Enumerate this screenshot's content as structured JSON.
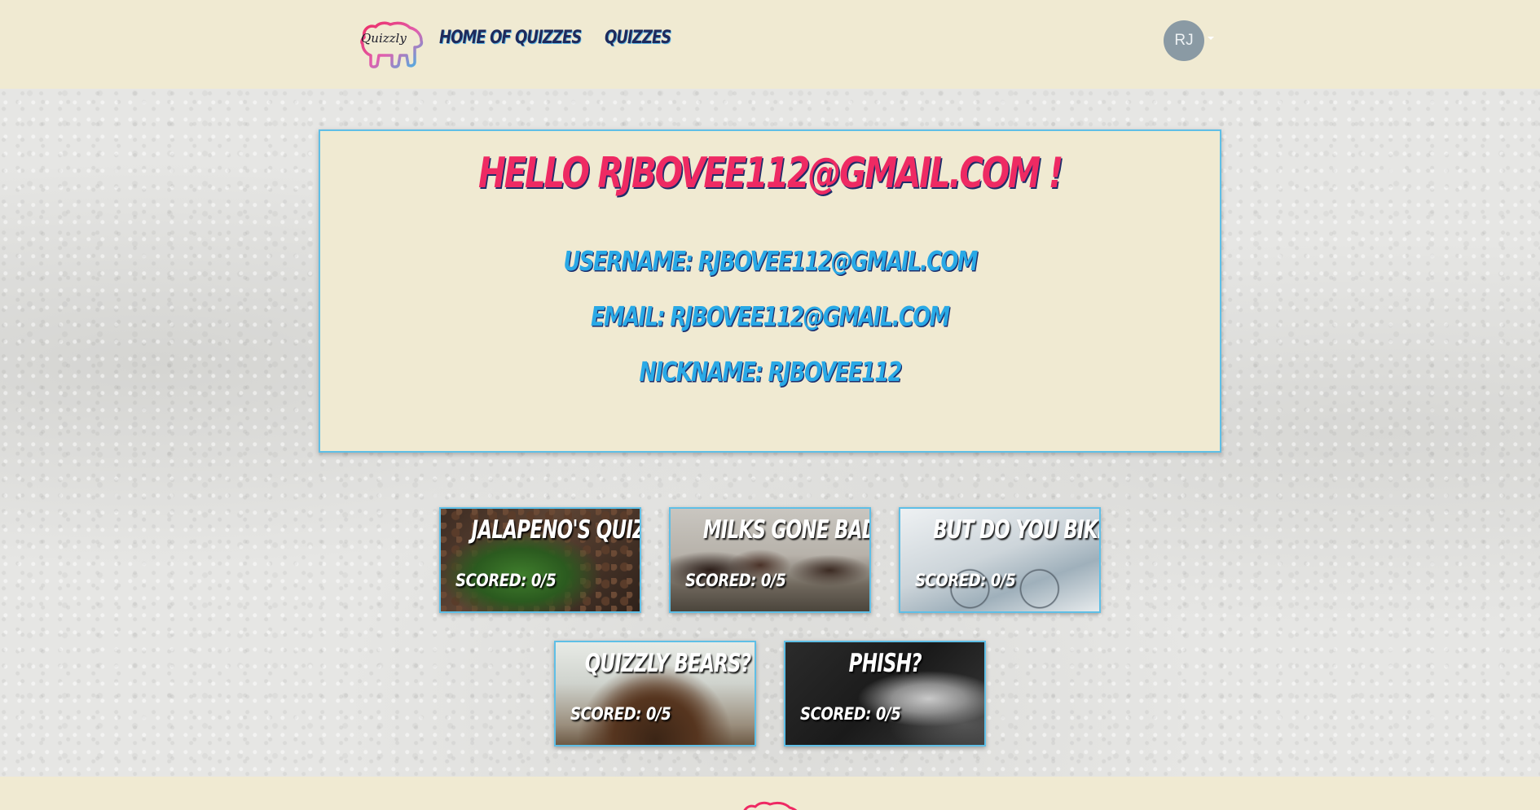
{
  "navbar": {
    "logo_text": "Quizzly",
    "links": [
      {
        "label": "Home of Quizzes"
      },
      {
        "label": "Quizzes"
      }
    ],
    "avatar_initials": "RJ"
  },
  "profile": {
    "greeting": "Hello rjbovee112@gmail.com !",
    "username_line": "Username: rjbovee112@gmail.com",
    "email_line": "Email: rjbovee112@gmail.com",
    "nickname_line": "Nickname: rjbovee112"
  },
  "quizzes": [
    {
      "title": "Jalapeno's Quiz",
      "score": "Scored: 0/5"
    },
    {
      "title": "Milks Gone Bad?",
      "score": "Scored: 0/5"
    },
    {
      "title": "But Do You Bike?",
      "score": "Scored: 0/5"
    },
    {
      "title": "Quizzly Bears?",
      "score": "Scored: 0/5"
    },
    {
      "title": "Phish?",
      "score": "Scored: 0/5"
    }
  ],
  "colors": {
    "cream": "#f0ead2",
    "accent_pink": "#ee2a63",
    "accent_blue": "#29a9e6",
    "navy": "#1d2d6a"
  },
  "icons": {
    "logo": "bear-logo-icon",
    "avatar_menu": "caret-down-icon"
  }
}
